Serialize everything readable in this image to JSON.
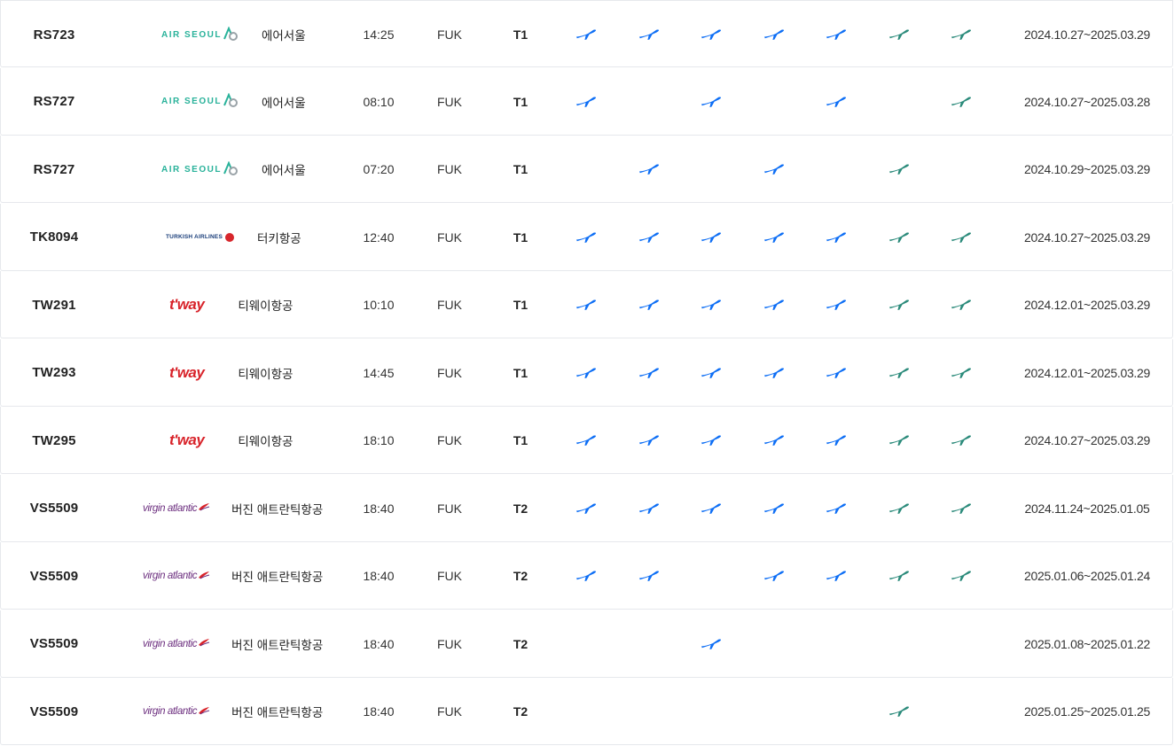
{
  "colors": {
    "weekday_plane": "#0d6ef5",
    "weekend_plane": "#2a8a7a",
    "airseoul": "#29b29a",
    "tway": "#d8232a",
    "turkish": "#1a3e7a",
    "virgin": "#6b2d7e"
  },
  "rows": [
    {
      "flight": "RS723",
      "logo": "air-seoul-logo",
      "logo_text": "AIR SEOUL",
      "airline": "에어서울",
      "time": "14:25",
      "dest": "FUK",
      "terminal": "T1",
      "days": [
        1,
        1,
        1,
        1,
        1,
        1,
        1
      ],
      "period": "2024.10.27~2025.03.29"
    },
    {
      "flight": "RS727",
      "logo": "air-seoul-logo",
      "logo_text": "AIR SEOUL",
      "airline": "에어서울",
      "time": "08:10",
      "dest": "FUK",
      "terminal": "T1",
      "days": [
        1,
        0,
        1,
        0,
        1,
        0,
        1
      ],
      "period": "2024.10.27~2025.03.28"
    },
    {
      "flight": "RS727",
      "logo": "air-seoul-logo",
      "logo_text": "AIR SEOUL",
      "airline": "에어서울",
      "time": "07:20",
      "dest": "FUK",
      "terminal": "T1",
      "days": [
        0,
        1,
        0,
        1,
        0,
        1,
        0
      ],
      "period": "2024.10.29~2025.03.29"
    },
    {
      "flight": "TK8094",
      "logo": "turkish-airlines-logo",
      "logo_text": "TURKISH AIRLINES",
      "airline": "터키항공",
      "time": "12:40",
      "dest": "FUK",
      "terminal": "T1",
      "days": [
        1,
        1,
        1,
        1,
        1,
        1,
        1
      ],
      "period": "2024.10.27~2025.03.29"
    },
    {
      "flight": "TW291",
      "logo": "tway-logo",
      "logo_text": "t'way",
      "airline": "티웨이항공",
      "time": "10:10",
      "dest": "FUK",
      "terminal": "T1",
      "days": [
        1,
        1,
        1,
        1,
        1,
        1,
        1
      ],
      "period": "2024.12.01~2025.03.29"
    },
    {
      "flight": "TW293",
      "logo": "tway-logo",
      "logo_text": "t'way",
      "airline": "티웨이항공",
      "time": "14:45",
      "dest": "FUK",
      "terminal": "T1",
      "days": [
        1,
        1,
        1,
        1,
        1,
        1,
        1
      ],
      "period": "2024.12.01~2025.03.29"
    },
    {
      "flight": "TW295",
      "logo": "tway-logo",
      "logo_text": "t'way",
      "airline": "티웨이항공",
      "time": "18:10",
      "dest": "FUK",
      "terminal": "T1",
      "days": [
        1,
        1,
        1,
        1,
        1,
        1,
        1
      ],
      "period": "2024.10.27~2025.03.29"
    },
    {
      "flight": "VS5509",
      "logo": "virgin-atlantic-logo",
      "logo_text": "virgin atlantic",
      "airline": "버진 애트란틱항공",
      "time": "18:40",
      "dest": "FUK",
      "terminal": "T2",
      "days": [
        1,
        1,
        1,
        1,
        1,
        1,
        1
      ],
      "period": "2024.11.24~2025.01.05"
    },
    {
      "flight": "VS5509",
      "logo": "virgin-atlantic-logo",
      "logo_text": "virgin atlantic",
      "airline": "버진 애트란틱항공",
      "time": "18:40",
      "dest": "FUK",
      "terminal": "T2",
      "days": [
        1,
        1,
        0,
        1,
        1,
        1,
        1
      ],
      "period": "2025.01.06~2025.01.24"
    },
    {
      "flight": "VS5509",
      "logo": "virgin-atlantic-logo",
      "logo_text": "virgin atlantic",
      "airline": "버진 애트란틱항공",
      "time": "18:40",
      "dest": "FUK",
      "terminal": "T2",
      "days": [
        0,
        0,
        1,
        0,
        0,
        0,
        0
      ],
      "period": "2025.01.08~2025.01.22"
    },
    {
      "flight": "VS5509",
      "logo": "virgin-atlantic-logo",
      "logo_text": "virgin atlantic",
      "airline": "버진 애트란틱항공",
      "time": "18:40",
      "dest": "FUK",
      "terminal": "T2",
      "days": [
        0,
        0,
        0,
        0,
        0,
        1,
        0
      ],
      "period": "2025.01.25~2025.01.25"
    }
  ]
}
